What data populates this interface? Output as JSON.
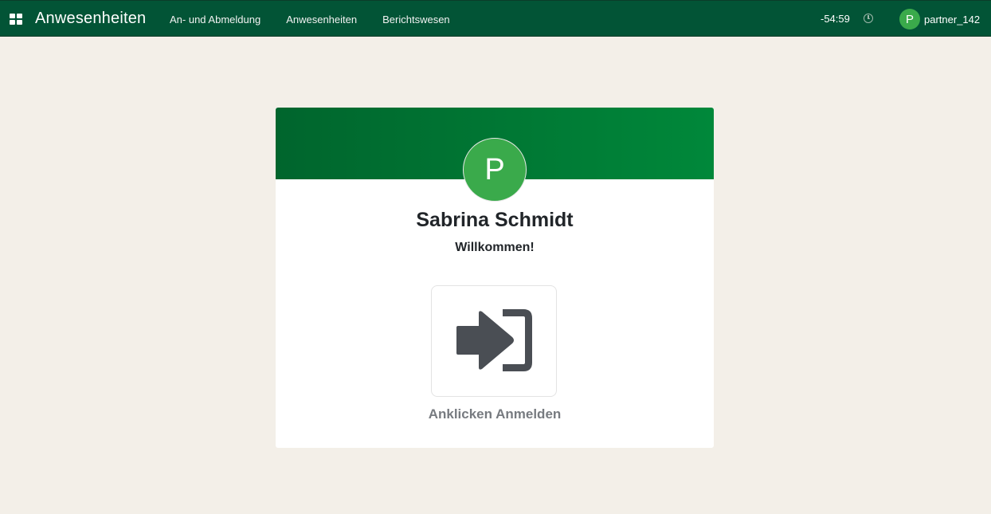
{
  "navbar": {
    "apps_icon": "apps-grid-icon",
    "app_title": "Anwesenheiten",
    "menu": [
      {
        "label": "An- und Abmeldung"
      },
      {
        "label": "Anwesenheiten"
      },
      {
        "label": "Berichtswesen"
      }
    ],
    "timer": "-54:59",
    "clock_icon": "clock-icon",
    "user": {
      "avatar_letter": "P",
      "name": "partner_142"
    }
  },
  "card": {
    "avatar_letter": "P",
    "employee_name": "Sabrina Schmidt",
    "welcome": "Willkommen!",
    "checkin_icon": "sign-in-icon",
    "checkin_label": "Anklicken Anmelden"
  },
  "colors": {
    "navbar_bg": "#025436",
    "header_gradient_start": "#00652d",
    "header_gradient_end": "#00883a",
    "avatar_green": "#3aaa4b",
    "page_bg": "#f3efe8",
    "icon_gray": "#4a4e54",
    "label_gray": "#777b80"
  }
}
